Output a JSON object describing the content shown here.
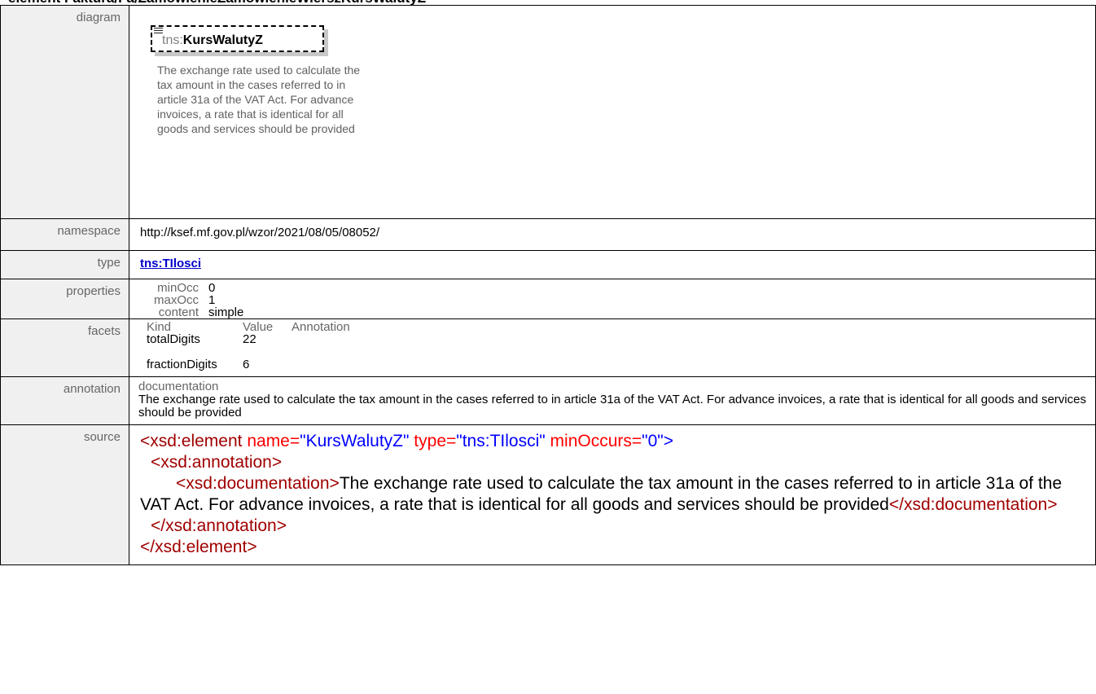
{
  "heading": "element Faktura/Fa/ZamowienieZamowienieWierszKursWalutyZ",
  "labels": {
    "diagram": "diagram",
    "namespace": "namespace",
    "type": "type",
    "properties": "properties",
    "facets": "facets",
    "annotation": "annotation",
    "source": "source"
  },
  "diagram": {
    "prefix": "tns:",
    "name": "KursWalutyZ",
    "description": "The exchange rate used to calculate the tax amount in the cases referred to in article 31a of the VAT Act. For advance invoices, a rate that is identical for all goods and services should be provided"
  },
  "namespace": "http://ksef.mf.gov.pl/wzor/2021/08/05/08052/",
  "type": "tns:TIlosci",
  "properties": [
    {
      "key": "minOcc",
      "value": "0"
    },
    {
      "key": "maxOcc",
      "value": "1"
    },
    {
      "key": "content",
      "value": "simple"
    }
  ],
  "facets": {
    "headers": [
      "Kind",
      "Value",
      "Annotation"
    ],
    "rows": [
      {
        "kind": "totalDigits",
        "value": "22"
      },
      {
        "kind": "fractionDigits",
        "value": "6"
      }
    ]
  },
  "annotation": {
    "header": "documentation",
    "text": "The exchange rate used to calculate the tax amount in the cases referred to in article 31a of the VAT Act. For advance invoices, a rate that is identical for all goods and services should be provided"
  },
  "source": {
    "l1_open": "<xsd:element",
    "l1_attr1": " name=",
    "l1_val1": "\"KursWalutyZ\"",
    "l1_attr2": " type=",
    "l1_val2": "\"tns:TIlosci\"",
    "l1_attr3": " minOccurs=",
    "l1_val3": "\"0\"",
    "l1_close": ">",
    "l2": "<xsd:annotation>",
    "l3_open": "<xsd:documentation>",
    "l3_text": "The exchange rate used to calculate the tax amount in the cases referred to in article 31a of the VAT Act. For advance invoices, a rate that is identical for all goods and services should be provided",
    "l3_close": "</xsd:documentation>",
    "l4": "</xsd:annotation>",
    "l5": "</xsd:element>"
  },
  "colors": {
    "tag": "#a00000",
    "attr": "#ff0000",
    "attr_value": "#0000ff",
    "link": "#0000cc",
    "label_bg": "#f0f0f0"
  }
}
